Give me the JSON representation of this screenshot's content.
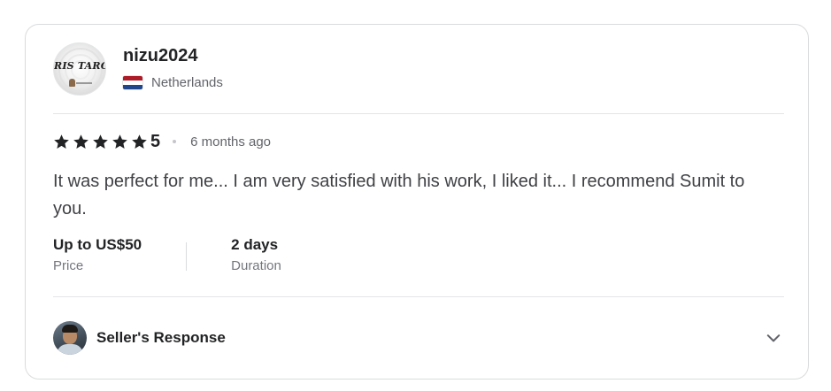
{
  "review": {
    "reviewer": {
      "username": "nizu2024",
      "country": "Netherlands",
      "flag_icon": "netherlands-flag-icon",
      "avatar_text": "RIS TAROT"
    },
    "rating": {
      "value": "5",
      "stars": 5,
      "star_color": "#222325",
      "time_ago": "6 months ago"
    },
    "text": "It was perfect for me... I am very satisfied with his work, I liked it... I recommend Sumit to you.",
    "meta": {
      "price_value": "Up to US$50",
      "price_label": "Price",
      "duration_value": "2 days",
      "duration_label": "Duration"
    },
    "seller_response": {
      "label": "Seller's Response",
      "expand_icon": "chevron-down-icon"
    }
  }
}
